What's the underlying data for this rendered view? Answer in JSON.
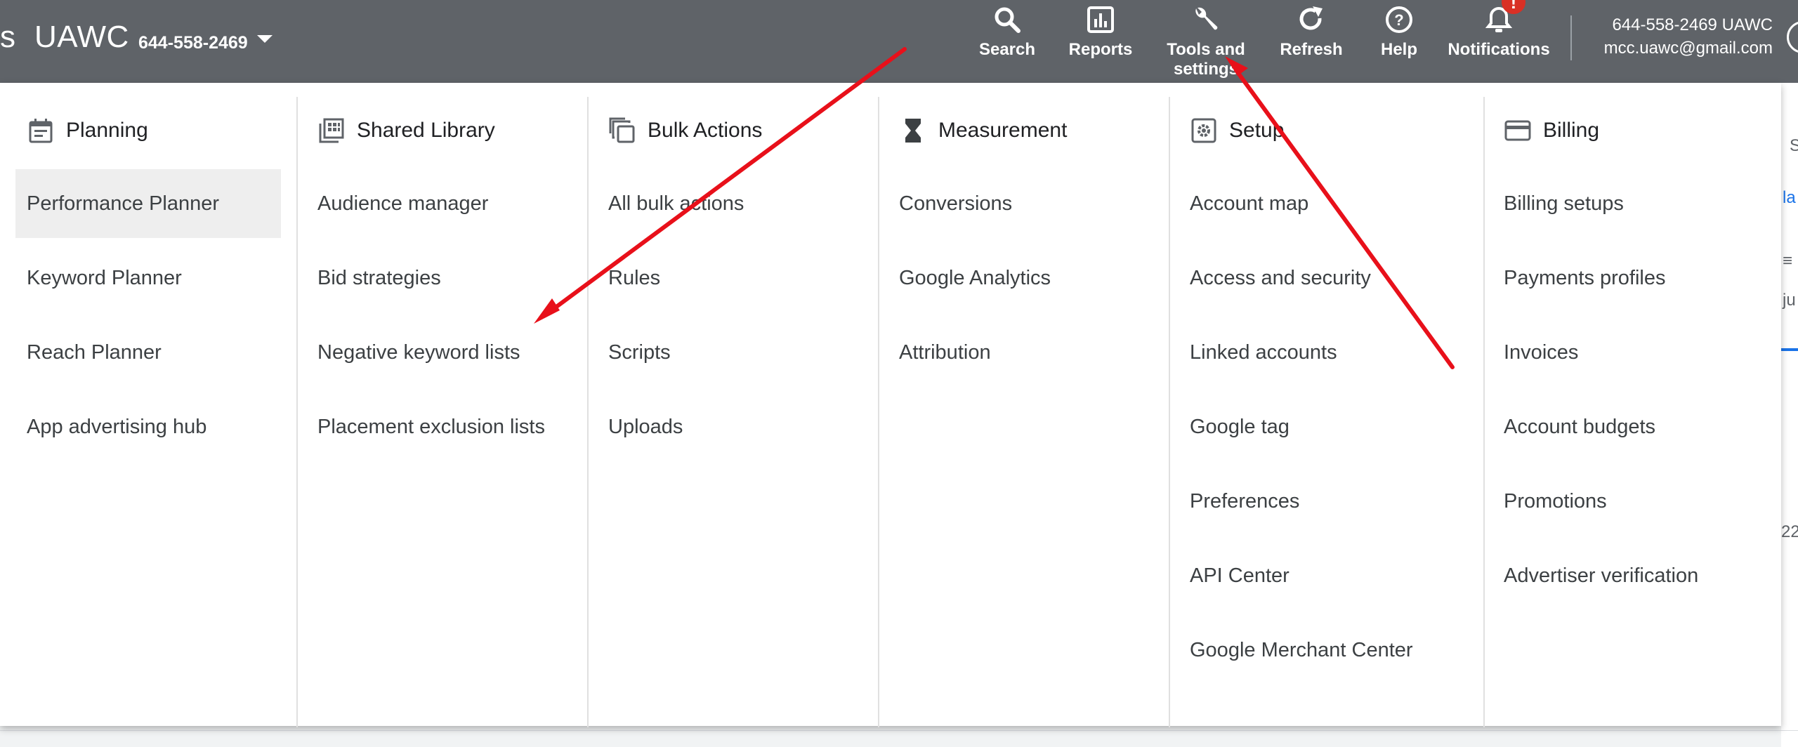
{
  "header": {
    "brand_cut": "s",
    "brand_name": "UAWC",
    "account_id": "644-558-2469",
    "nav": [
      {
        "label": "Search",
        "icon": "search-icon"
      },
      {
        "label": "Reports",
        "icon": "reports-icon"
      },
      {
        "label": "Tools and settings",
        "label_line1": "Tools and",
        "label_line2": "settings",
        "icon": "wrench-icon"
      },
      {
        "label": "Refresh",
        "icon": "refresh-icon"
      },
      {
        "label": "Help",
        "icon": "help-icon"
      },
      {
        "label": "Notifications",
        "icon": "bell-icon",
        "badge": "!"
      }
    ],
    "account_name": "644-558-2469 UAWC",
    "account_email": "mcc.uawc@gmail.com"
  },
  "menu": {
    "columns": [
      {
        "title": "Planning",
        "icon": "calendar-icon",
        "items": [
          "Performance Planner",
          "Keyword Planner",
          "Reach Planner",
          "App advertising hub"
        ],
        "active_index": 0
      },
      {
        "title": "Shared Library",
        "icon": "library-grid-icon",
        "items": [
          "Audience manager",
          "Bid strategies",
          "Negative keyword lists",
          "Placement exclusion lists"
        ]
      },
      {
        "title": "Bulk Actions",
        "icon": "copy-stack-icon",
        "items": [
          "All bulk actions",
          "Rules",
          "Scripts",
          "Uploads"
        ]
      },
      {
        "title": "Measurement",
        "icon": "hourglass-icon",
        "items": [
          "Conversions",
          "Google Analytics",
          "Attribution"
        ]
      },
      {
        "title": "Setup",
        "icon": "settings-gear-icon",
        "items": [
          "Account map",
          "Access and security",
          "Linked accounts",
          "Google tag",
          "Preferences",
          "API Center",
          "Google Merchant Center"
        ]
      },
      {
        "title": "Billing",
        "icon": "credit-card-icon",
        "items": [
          "Billing setups",
          "Payments profiles",
          "Invoices",
          "Account budgets",
          "Promotions",
          "Advertiser verification"
        ]
      }
    ]
  },
  "background_fragments": [
    "S",
    "la",
    "ju",
    "22"
  ],
  "colors": {
    "topbar": "#5f6368",
    "panel": "#ffffff",
    "active_item": "#eeeeee",
    "annotation_arrow": "#e8101a",
    "notification_badge": "#d93025",
    "link_blue": "#1a73e8"
  }
}
